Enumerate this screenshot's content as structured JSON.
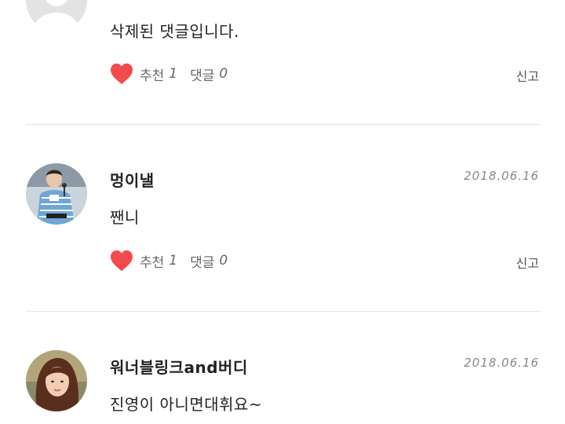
{
  "colors": {
    "heart": "#f24b4b",
    "divider": "#dfe6e3",
    "date_text": "#888888",
    "action_text": "#666666"
  },
  "comments": [
    {
      "username": "",
      "date": "",
      "text": "삭제된 댓글입니다.",
      "like_label": "추천",
      "like_count": "1",
      "reply_label": "댓글",
      "reply_count": "0",
      "report_label": "신고",
      "avatar_icon": "default-user-icon"
    },
    {
      "username": "멍이낼",
      "date": "2018.06.16",
      "text": "짼니",
      "like_label": "추천",
      "like_count": "1",
      "reply_label": "댓글",
      "reply_count": "0",
      "report_label": "신고",
      "avatar_icon": "user-photo-avatar"
    },
    {
      "username": "워너블링크and버디",
      "date": "2018.06.16",
      "text": "진영이 아니면대휘요~",
      "avatar_icon": "user-photo-avatar"
    }
  ]
}
